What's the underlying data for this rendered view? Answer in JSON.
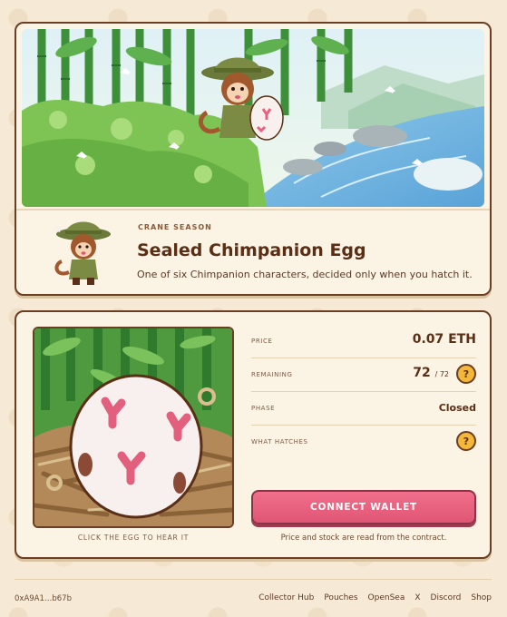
{
  "hero": {
    "eyebrow": "CRANE SEASON",
    "title": "Sealed Chimpanion Egg",
    "subtitle": "One of six Chimpanion characters, decided only when you hatch it."
  },
  "product": {
    "price_label": "PRICE",
    "price_value": "0.07 ETH",
    "remaining_label": "REMAINING",
    "remaining_value": "72",
    "remaining_total": "/ 72",
    "phase_label": "PHASE",
    "phase_value": "Closed",
    "hatches_label": "WHAT HATCHES",
    "help_symbol": "?",
    "egg_caption": "CLICK THE EGG TO HEAR IT",
    "connect_label": "CONNECT WALLET",
    "note": "Price and stock are read from the contract."
  },
  "footer": {
    "address": "0xA9A1…b67b",
    "links": [
      "Collector Hub",
      "Pouches",
      "OpenSea",
      "X",
      "Discord",
      "Shop"
    ]
  },
  "colors": {
    "background": "#f6ead6",
    "card": "#fbf3e4",
    "border": "#6b3e24",
    "accent_pink": "#e8617e",
    "help_yellow": "#f3b73a"
  },
  "icons": [
    "help-icon"
  ]
}
